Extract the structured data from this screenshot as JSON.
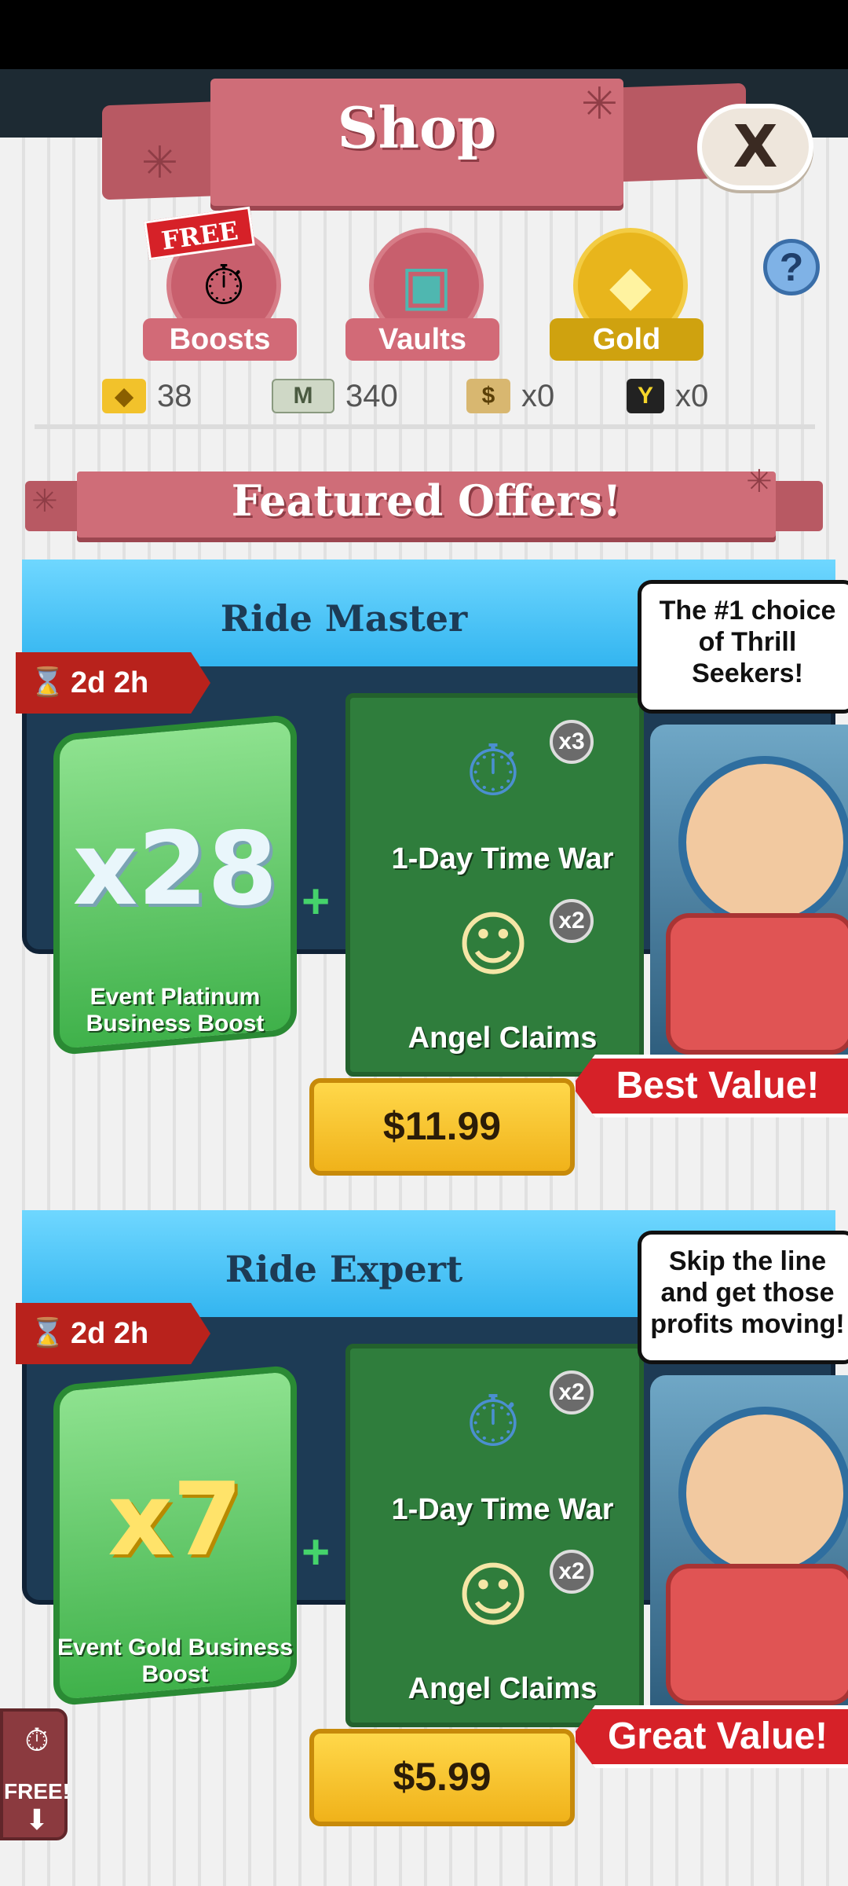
{
  "header": {
    "title": "Shop",
    "close_label": "X"
  },
  "tabs": [
    {
      "label": "Boosts",
      "icon": "boost-icon",
      "badge": "FREE"
    },
    {
      "label": "Vaults",
      "icon": "vault-icon"
    },
    {
      "label": "Gold",
      "icon": "gold-icon"
    }
  ],
  "help": {
    "label": "?"
  },
  "currencies": [
    {
      "icon": "gold-bar-icon",
      "value": "38"
    },
    {
      "icon": "megabucks-icon",
      "value": "340"
    },
    {
      "icon": "money-bag-icon",
      "value": "x0"
    },
    {
      "icon": "event-token-icon",
      "value": "x0"
    }
  ],
  "section": {
    "title": "Featured Offers!"
  },
  "offers": [
    {
      "title": "Ride Master",
      "timer": "2d 2h",
      "boost": {
        "multiplier": "x28",
        "name": "Event Platinum Business Boost"
      },
      "items": [
        {
          "label": "1-Day Time War",
          "count": "x3",
          "icon": "stopwatch-icon"
        },
        {
          "label": "Angel Claims",
          "count": "x2",
          "icon": "angel-icon"
        }
      ],
      "speech": "The #1 choice of Thrill Seekers!",
      "tag": "Best Value!",
      "price": "$11.99"
    },
    {
      "title": "Ride Expert",
      "timer": "2d 2h",
      "boost": {
        "multiplier": "x7",
        "name": "Event Gold Business Boost"
      },
      "items": [
        {
          "label": "1-Day Time War",
          "count": "x2",
          "icon": "stopwatch-icon"
        },
        {
          "label": "Angel Claims",
          "count": "x2",
          "icon": "angel-icon"
        }
      ],
      "speech": "Skip the line and get those profits moving!",
      "tag": "Great Value!",
      "price": "$5.99"
    }
  ],
  "side_button": {
    "label": "FREE!"
  },
  "colors": {
    "header_pink": "#cf6d78",
    "offer_blue": "#33b5f0",
    "item_green": "#2f7d3c",
    "price_yellow": "#ffd84a",
    "tag_red": "#d62128"
  }
}
